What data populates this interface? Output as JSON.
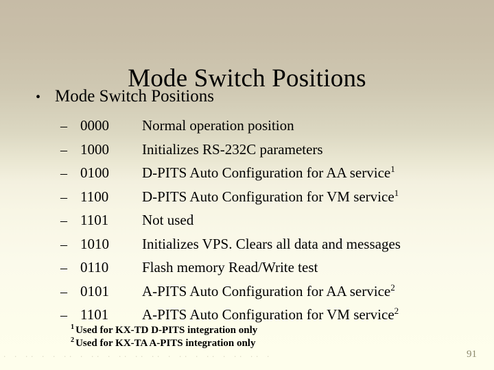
{
  "slide": {
    "title": "Mode Switch Positions",
    "bullet_glyph": "•",
    "dash_glyph": "–",
    "heading": "Mode Switch Positions",
    "page_number": "91",
    "bottom_artifact": "· ·  ·· ·   · ·· · ··  · ·· ··  ·· · ·· ·  ·· · ··   ·· ·",
    "items": [
      {
        "code": "0000",
        "desc": "Normal operation position",
        "note": ""
      },
      {
        "code": "1000",
        "desc": "Initializes RS-232C parameters",
        "note": ""
      },
      {
        "code": "0100",
        "desc": "D-PITS Auto Configuration for AA service",
        "note": "1"
      },
      {
        "code": "1100",
        "desc": "D-PITS Auto Configuration for VM service",
        "note": "1"
      },
      {
        "code": "1101",
        "desc": "Not used",
        "note": ""
      },
      {
        "code": "1010",
        "desc": "Initializes VPS. Clears all data and messages",
        "note": ""
      },
      {
        "code": "0110",
        "desc": "Flash memory Read/Write test",
        "note": ""
      },
      {
        "code": "0101",
        "desc": "A-PITS Auto Configuration for AA service",
        "note": "2"
      },
      {
        "code": "1101",
        "desc": "A-PITS Auto Configuration for VM service",
        "note": "2"
      }
    ],
    "footnotes": [
      {
        "marker": "1",
        "text": "Used for KX-TD D-PITS integration only"
      },
      {
        "marker": "2",
        "text": "Used for KX-TA A-PITS integration only"
      }
    ],
    "colors": {
      "background_top": "#C6BBA6",
      "background_bottom": "#FDFDEB",
      "text": "#000000",
      "page_number": "#8D8A6D"
    }
  }
}
